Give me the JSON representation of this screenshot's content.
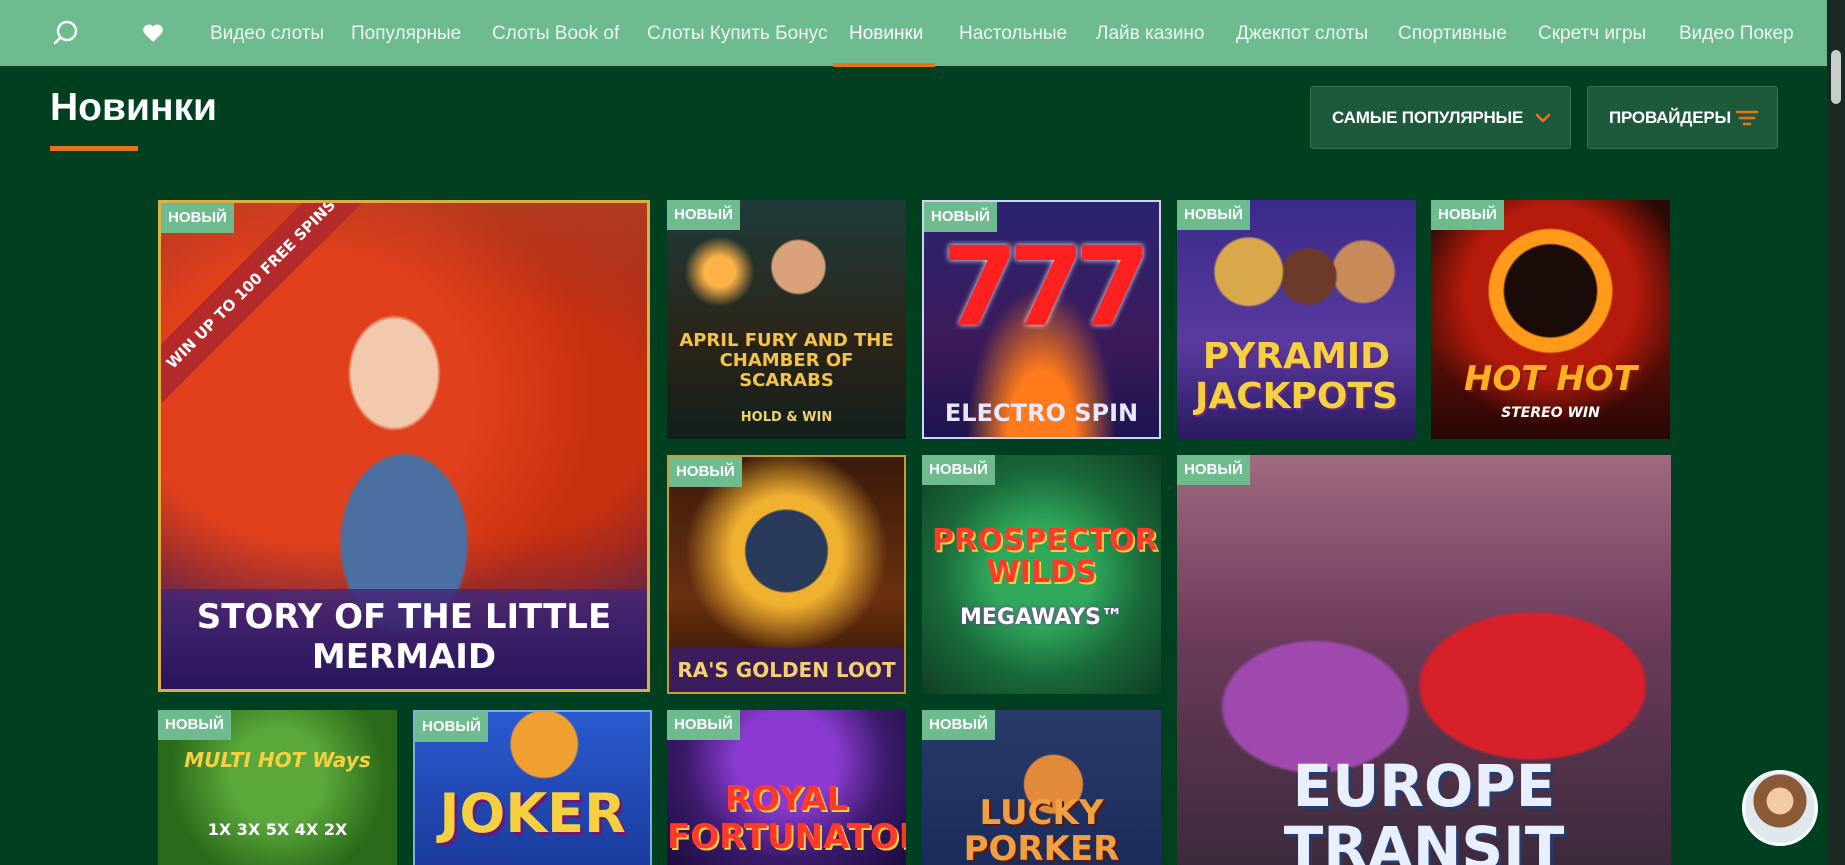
{
  "nav": {
    "items": [
      "Видео слоты",
      "Популярные",
      "Слоты Book of",
      "Слоты Купить Бонус",
      "Новинки",
      "Настольные",
      "Лайв казино",
      "Джекпот слоты",
      "Спортивные",
      "Скретч игры",
      "Видео Покер"
    ],
    "active_index": 4
  },
  "header": {
    "title": "Новинки",
    "sort_label": "САМЫЕ ПОПУЛЯРНЫЕ",
    "providers_label": "ПРОВАЙДЕРЫ"
  },
  "badge_label": "НОВЫЙ",
  "colors": {
    "background": "#003f1f",
    "nav": "#6dbb8e",
    "accent": "#e8731a",
    "button": "#1d5a3b"
  },
  "games": [
    {
      "title": "STORY OF THE LITTLE MERMAID",
      "ribbon": "WIN UP TO 100 FREE SPINS"
    },
    {
      "title": "APRIL FURY AND THE CHAMBER OF SCARABS",
      "subtitle": "HOLD & WIN"
    },
    {
      "title": "777",
      "subtitle": "ELECTRO SPIN"
    },
    {
      "title": "PYRAMID JACKPOTS"
    },
    {
      "title": "HOT HOT",
      "subtitle": "STEREO WIN"
    },
    {
      "title": "RA'S GOLDEN LOOT"
    },
    {
      "title": "PROSPECTOR WILDS",
      "subtitle": "MEGAWAYS™"
    },
    {
      "title": "EUROPE TRANSIT"
    },
    {
      "title": "MULTI HOT Ways",
      "subtitle": "1X 3X 5X 4X 2X"
    },
    {
      "title": "JOKER"
    },
    {
      "title": "ROYAL FORTUNATOR"
    },
    {
      "title": "LUCKY PORKER"
    }
  ]
}
